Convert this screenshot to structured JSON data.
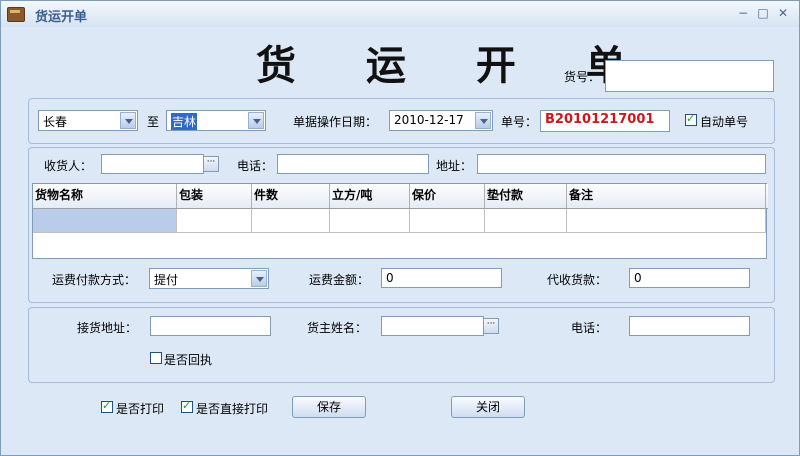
{
  "window": {
    "title": "货运开单"
  },
  "heading": "货 运 开 单",
  "cargo_no": {
    "label": "货号：",
    "value": ""
  },
  "route": {
    "from": "长春",
    "to_label": "至",
    "to": "吉林"
  },
  "date": {
    "label": "单据操作日期：",
    "value": "2010-12-17"
  },
  "order_no": {
    "label": "单号：",
    "value": "B20101217001"
  },
  "auto_no": {
    "label": "自动单号",
    "checked": true
  },
  "consignee": {
    "label": "收货人：",
    "value": "",
    "phone_label": "电话：",
    "phone": "",
    "address_label": "地址：",
    "address": ""
  },
  "grid": {
    "columns": [
      "货物名称",
      "包装",
      "件数",
      "立方/吨",
      "保价",
      "垫付款",
      "备注"
    ]
  },
  "payment": {
    "method_label": "运费付款方式：",
    "method": "提付",
    "amount_label": "运费金额：",
    "amount": "0",
    "cod_label": "代收货款：",
    "cod": "0"
  },
  "pickup": {
    "address_label": "接货地址：",
    "address": "",
    "owner_label": "货主姓名：",
    "owner": "",
    "phone_label": "电话：",
    "phone": "",
    "receipt_label": "是否回执",
    "receipt_checked": false
  },
  "footer": {
    "print_label": "是否打印",
    "print_checked": true,
    "direct_print_label": "是否直接打印",
    "direct_print_checked": true,
    "save_label": "保存",
    "close_label": "关闭"
  }
}
